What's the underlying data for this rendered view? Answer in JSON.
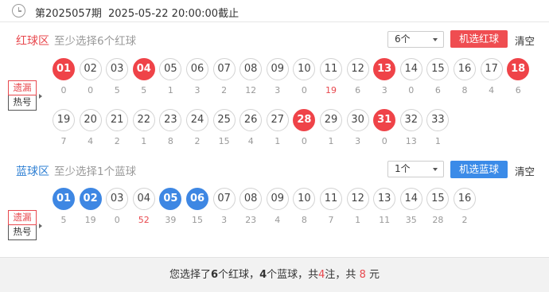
{
  "header": {
    "issue": "第2025057期",
    "deadline": "2025-05-22 20:00:00截止"
  },
  "red": {
    "name": "红球区",
    "hint": "至少选择6个红球",
    "select_value": "6个",
    "random_btn": "机选红球",
    "clear": "清空",
    "tag_top": "遗漏",
    "tag_bottom": "热号",
    "balls": [
      {
        "n": "01",
        "miss": "0",
        "sel": true
      },
      {
        "n": "02",
        "miss": "0"
      },
      {
        "n": "03",
        "miss": "5"
      },
      {
        "n": "04",
        "miss": "5",
        "sel": true
      },
      {
        "n": "05",
        "miss": "1"
      },
      {
        "n": "06",
        "miss": "3"
      },
      {
        "n": "07",
        "miss": "2"
      },
      {
        "n": "08",
        "miss": "12"
      },
      {
        "n": "09",
        "miss": "3"
      },
      {
        "n": "10",
        "miss": "0"
      },
      {
        "n": "11",
        "miss": "19",
        "hot": true
      },
      {
        "n": "12",
        "miss": "6"
      },
      {
        "n": "13",
        "miss": "3",
        "sel": true
      },
      {
        "n": "14",
        "miss": "0"
      },
      {
        "n": "15",
        "miss": "6"
      },
      {
        "n": "16",
        "miss": "8"
      },
      {
        "n": "17",
        "miss": "4"
      },
      {
        "n": "18",
        "miss": "6",
        "sel": true
      },
      {
        "n": "19",
        "miss": "7"
      },
      {
        "n": "20",
        "miss": "4"
      },
      {
        "n": "21",
        "miss": "2"
      },
      {
        "n": "22",
        "miss": "1"
      },
      {
        "n": "23",
        "miss": "8"
      },
      {
        "n": "24",
        "miss": "2"
      },
      {
        "n": "25",
        "miss": "15"
      },
      {
        "n": "26",
        "miss": "4"
      },
      {
        "n": "27",
        "miss": "1"
      },
      {
        "n": "28",
        "miss": "0",
        "sel": true
      },
      {
        "n": "29",
        "miss": "1"
      },
      {
        "n": "30",
        "miss": "3"
      },
      {
        "n": "31",
        "miss": "0",
        "sel": true
      },
      {
        "n": "32",
        "miss": "13"
      },
      {
        "n": "33",
        "miss": "1"
      }
    ]
  },
  "blue": {
    "name": "蓝球区",
    "hint": "至少选择1个蓝球",
    "select_value": "1个",
    "random_btn": "机选蓝球",
    "clear": "清空",
    "tag_top": "遗漏",
    "tag_bottom": "热号",
    "balls": [
      {
        "n": "01",
        "miss": "5",
        "sel": true
      },
      {
        "n": "02",
        "miss": "19",
        "sel": true
      },
      {
        "n": "03",
        "miss": "0"
      },
      {
        "n": "04",
        "miss": "52",
        "hot": true
      },
      {
        "n": "05",
        "miss": "39",
        "sel": true
      },
      {
        "n": "06",
        "miss": "15",
        "sel": true
      },
      {
        "n": "07",
        "miss": "3"
      },
      {
        "n": "08",
        "miss": "23"
      },
      {
        "n": "09",
        "miss": "4"
      },
      {
        "n": "10",
        "miss": "8"
      },
      {
        "n": "11",
        "miss": "7"
      },
      {
        "n": "12",
        "miss": "1"
      },
      {
        "n": "13",
        "miss": "11"
      },
      {
        "n": "14",
        "miss": "35"
      },
      {
        "n": "15",
        "miss": "28"
      },
      {
        "n": "16",
        "miss": "2"
      }
    ]
  },
  "footer": {
    "p1": "您选择了",
    "red_count": "6",
    "p2": "个红球，",
    "blue_count": "4",
    "p3": "个蓝球，共",
    "bets": "4",
    "p4": "注，共",
    "amount": "8",
    "p5": "元"
  }
}
